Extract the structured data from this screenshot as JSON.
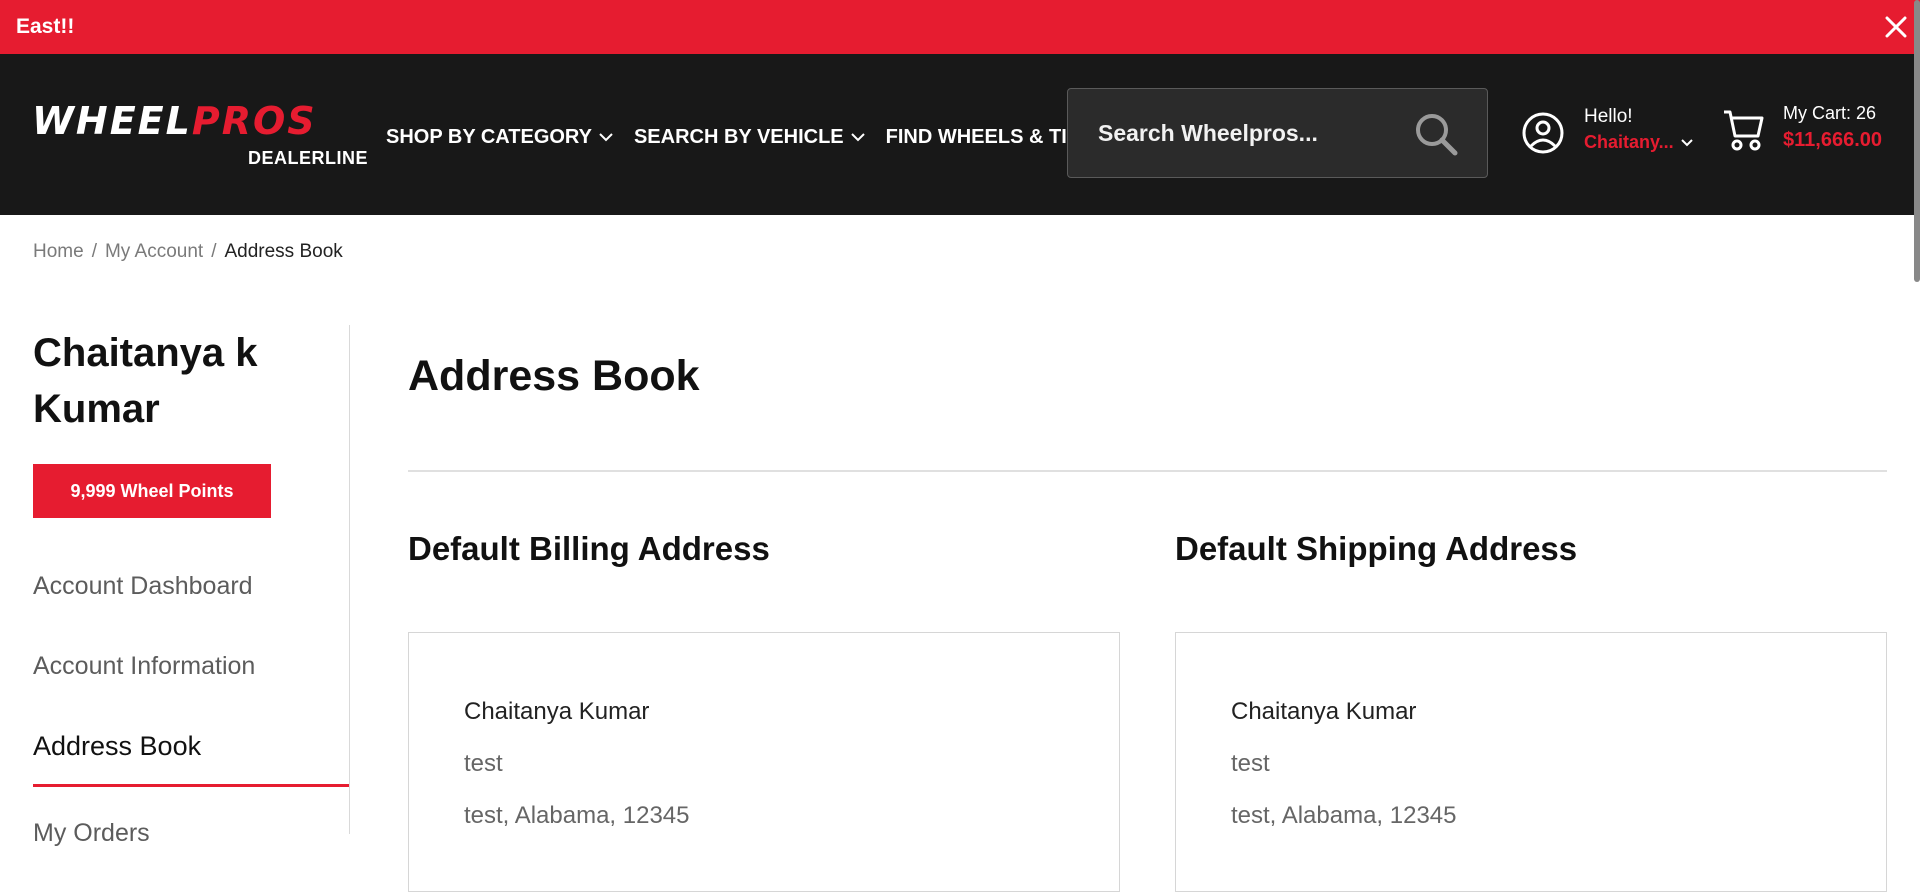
{
  "announcement": {
    "text": "East!!"
  },
  "header": {
    "logo": {
      "wheel": "WHEEL",
      "pros": "PROS",
      "sub": "DEALERLINE"
    },
    "nav": [
      {
        "label": "SHOP BY CATEGORY"
      },
      {
        "label": "SEARCH BY VEHICLE"
      },
      {
        "label": "FIND WHEELS & TIRES"
      }
    ],
    "search": {
      "placeholder": "Search Wheelpros..."
    },
    "user": {
      "greeting": "Hello!",
      "name": "Chaitany..."
    },
    "cart": {
      "count": "My Cart: 26",
      "total": "$11,666.00"
    }
  },
  "breadcrumb": {
    "home": "Home",
    "account": "My Account",
    "current": "Address Book"
  },
  "sidebar": {
    "name": "Chaitanya k Kumar",
    "points": "9,999 Wheel Points",
    "links": {
      "dashboard": "Account Dashboard",
      "information": "Account Information",
      "address_book": "Address Book",
      "cut": "My Orders"
    }
  },
  "main": {
    "title": "Address Book",
    "billing": {
      "title": "Default Billing Address",
      "name": "Chaitanya Kumar",
      "line1": "test",
      "line2": "test, Alabama, 12345"
    },
    "shipping": {
      "title": "Default Shipping Address",
      "name": "Chaitanya Kumar",
      "line1": "test",
      "line2": "test, Alabama, 12345"
    }
  },
  "colors": {
    "brand_red": "#e61c30",
    "header_bg": "#181818"
  }
}
